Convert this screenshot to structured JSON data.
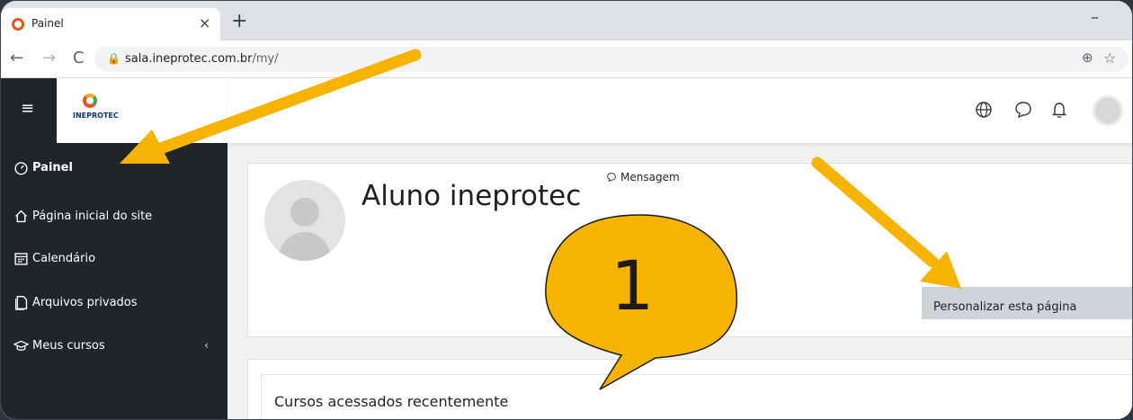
{
  "browser": {
    "tab_title": "Painel",
    "tab_close": "×",
    "new_tab": "+",
    "minimize": "–",
    "url_host": "sala.ineprotec.com.br",
    "url_path": "/my/"
  },
  "logo": {
    "text": "INEPROTEC"
  },
  "sidebar": {
    "items": [
      {
        "label": "Painel",
        "icon": "dashboard-icon"
      },
      {
        "label": "Página inicial do site",
        "icon": "home-icon"
      },
      {
        "label": "Calendário",
        "icon": "calendar-icon"
      },
      {
        "label": "Arquivos privados",
        "icon": "files-icon"
      },
      {
        "label": "Meus cursos",
        "icon": "graduation-cap-icon"
      }
    ]
  },
  "profile": {
    "name": "Aluno ineprotec",
    "message_link": "Mensagem",
    "customize_button": "Personalizar esta página"
  },
  "recent": {
    "title": "Cursos acessados recentemente"
  },
  "annotation": {
    "bubble_number": "1"
  },
  "colors": {
    "sidebar_bg": "#212529",
    "arrow": "#f6b400",
    "bubble": "#f6b400",
    "button_bg": "#ced4da",
    "logo_orange": "#e8541b"
  }
}
